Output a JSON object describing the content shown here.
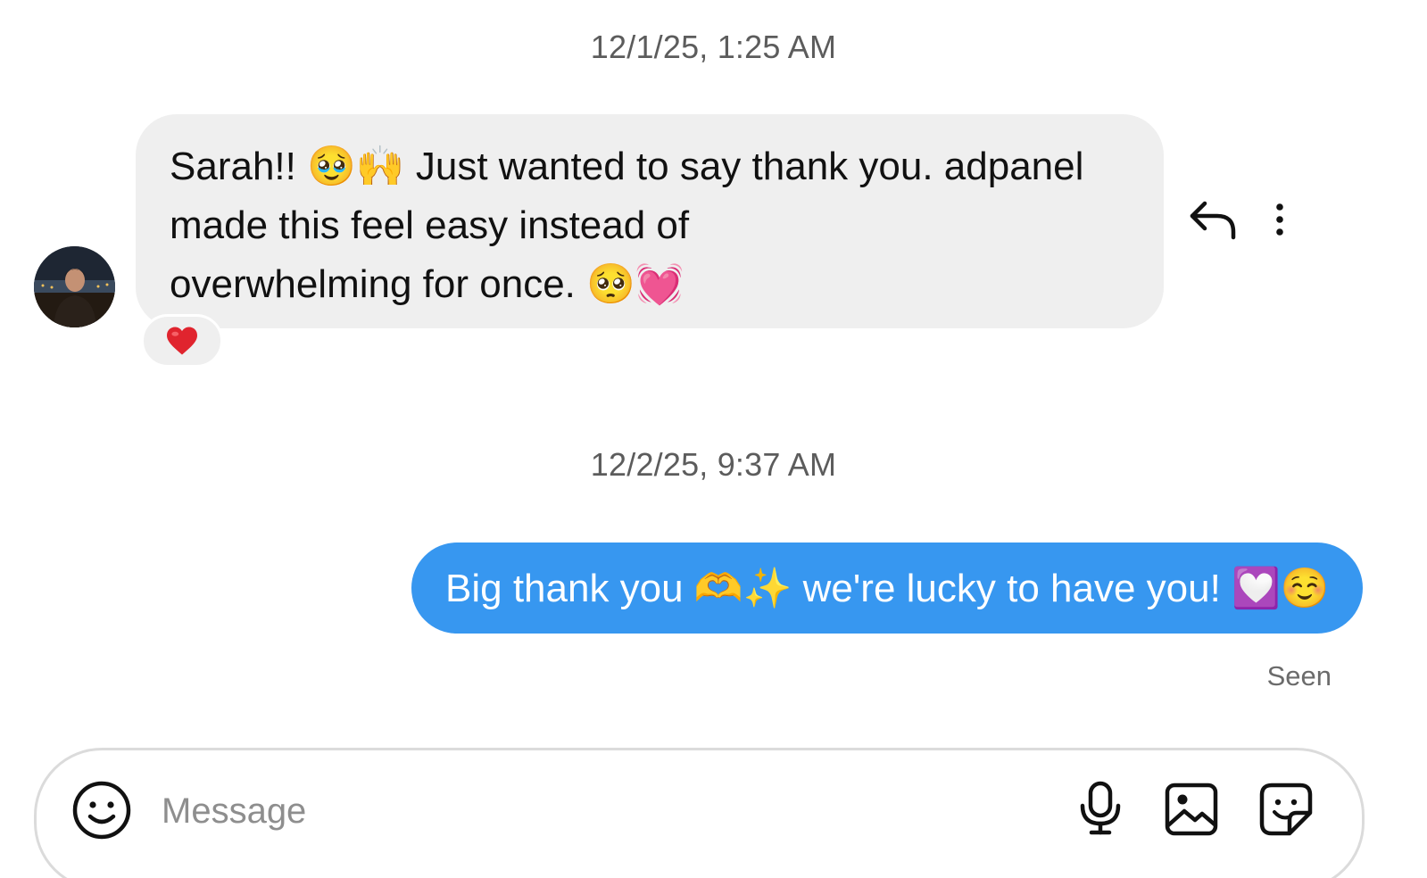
{
  "thread": {
    "timestamp_1": "12/1/25, 1:25 AM",
    "timestamp_2": "12/2/25, 9:37 AM",
    "incoming_message": {
      "text": "Sarah!! 🥹🙌 Just wanted to say thank you. adpanel\nmade this feel easy instead of\noverwhelming for once. 🥺💓",
      "reaction": "❤️"
    },
    "outgoing_message": {
      "text": "Big thank you 🫶✨ we're lucky to have you! 💟☺️",
      "status": "Seen"
    }
  },
  "composer": {
    "placeholder": "Message"
  },
  "icons": {
    "reply": "reply-arrow-icon",
    "more": "more-vertical-icon",
    "emoji": "smiley-icon",
    "mic": "microphone-icon",
    "image": "image-icon",
    "sticker": "sticker-icon"
  },
  "colors": {
    "outgoing_bubble": "#3797f0",
    "incoming_bubble": "#efefef",
    "reaction_heart": "#e0242e",
    "muted_text": "#5c5c5c"
  }
}
